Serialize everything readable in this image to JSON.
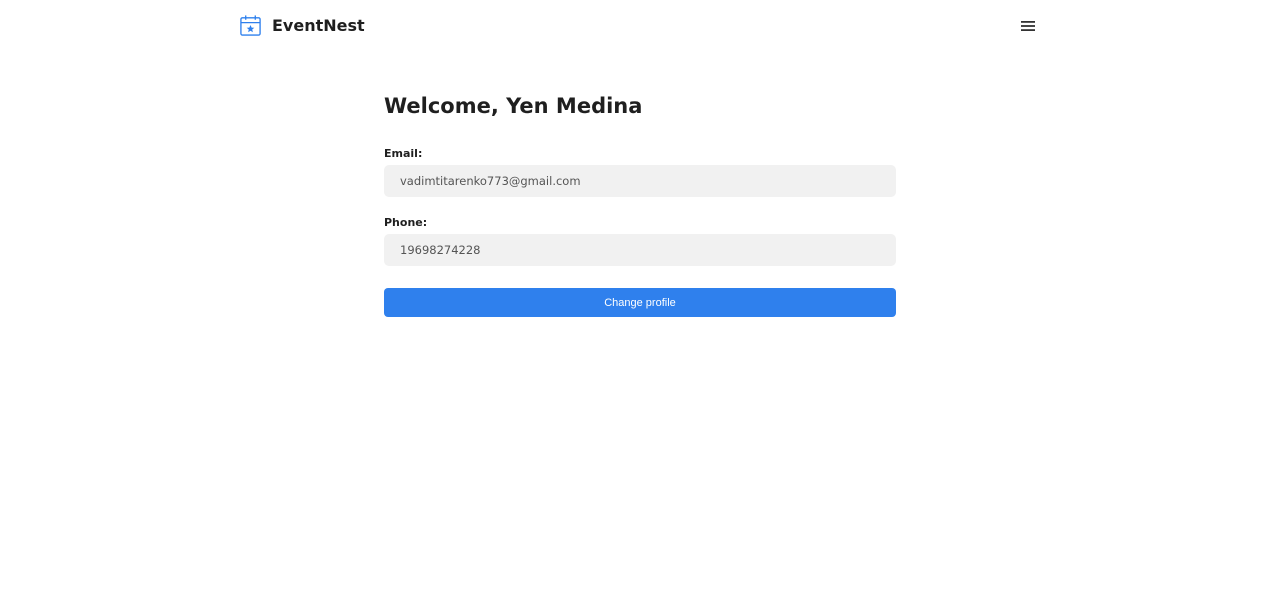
{
  "header": {
    "brand_name": "EventNest",
    "brand_icon": "calendar-star-icon",
    "menu_icon": "hamburger-menu-icon"
  },
  "profile": {
    "title": "Welcome, Yen Medina",
    "email_label": "Email:",
    "email_value": "vadimtitarenko773@gmail.com",
    "phone_label": "Phone:",
    "phone_value": "19698274228",
    "change_button_label": "Change profile"
  },
  "colors": {
    "accent": "#2f80ed",
    "field_background": "#f1f1f1",
    "text": "#1f1f1f"
  }
}
